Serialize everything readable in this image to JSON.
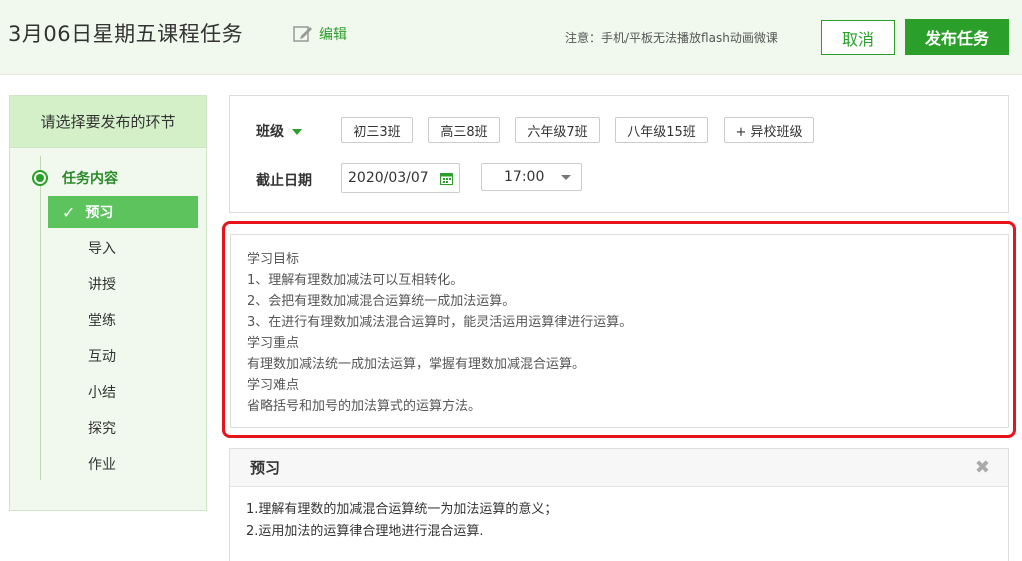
{
  "header": {
    "title": "3月06日星期五课程任务",
    "edit_label": "编辑",
    "notice": "注意：手机/平板无法播放flash动画微课",
    "cancel_label": "取消",
    "publish_label": "发布任务"
  },
  "sidebar": {
    "heading": "请选择要发布的环节",
    "section_label": "任务内容",
    "steps": [
      {
        "label": "预习",
        "active": true
      },
      {
        "label": "导入",
        "active": false
      },
      {
        "label": "讲授",
        "active": false
      },
      {
        "label": "堂练",
        "active": false
      },
      {
        "label": "互动",
        "active": false
      },
      {
        "label": "小结",
        "active": false
      },
      {
        "label": "探究",
        "active": false
      },
      {
        "label": "作业",
        "active": false
      }
    ]
  },
  "form": {
    "class_label": "班级",
    "classes": [
      "初三3班",
      "高三8班",
      "六年级7班",
      "八年级15班",
      "+ 异校班级"
    ],
    "deadline_label": "截止日期",
    "deadline_date": "2020/03/07",
    "deadline_time": "17:00"
  },
  "objectives": [
    "学习目标",
    "1、理解有理数加减法可以互相转化。",
    "2、会把有理数加减混合运算统一成加法运算。",
    "3、在进行有理数加减法混合运算时，能灵活运用运算律进行运算。",
    "学习重点",
    "有理数加减法统一成加法运算，掌握有理数加减混合运算。",
    "学习难点",
    "省略括号和加号的加法算式的运算方法。"
  ],
  "preview": {
    "title": "预习",
    "lines": [
      "1.理解有理数的加减混合运算统一为加法运算的意义；",
      "2.运用加法的运算律合理地进行混合运算."
    ]
  },
  "colors": {
    "accent": "#2aa02a",
    "highlight": "#e8141c",
    "header_bg": "#f1f9ee",
    "active_step": "#5dc45d"
  }
}
